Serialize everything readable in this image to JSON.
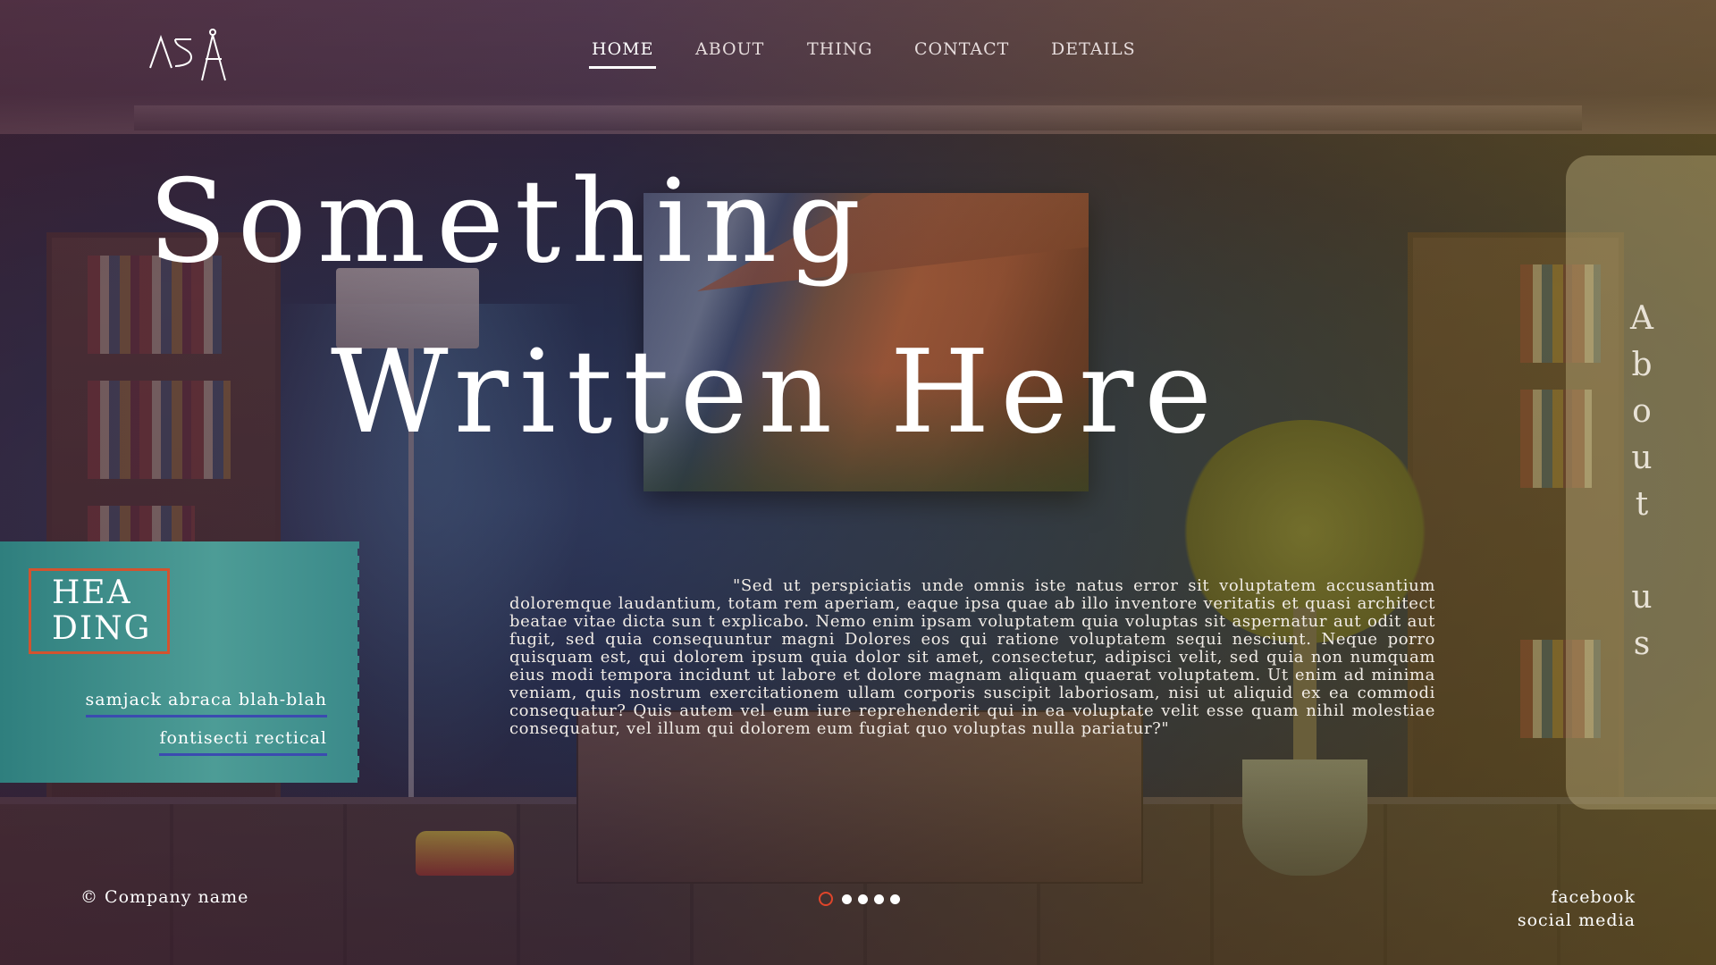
{
  "header": {
    "logo_icon": "compass-logo-icon",
    "nav": [
      {
        "label": "HOME",
        "active": true
      },
      {
        "label": "ABOUT",
        "active": false
      },
      {
        "label": "THING",
        "active": false
      },
      {
        "label": "CONTACT",
        "active": false
      },
      {
        "label": "DETAILS",
        "active": false
      }
    ]
  },
  "hero": {
    "line1": "Something",
    "line2": "Written Here"
  },
  "quote": "\"Sed ut perspiciatis unde omnis iste natus error sit voluptatem accusantium doloremque laudantium, totam rem aperiam, eaque ipsa quae ab illo inventore veritatis et quasi architect beatae vitae dicta sun t explicabo. Nemo enim ipsam voluptatem quia voluptas sit aspernatur aut odit aut fugit, sed quia consequuntur magni Dolores eos qui ratione voluptatem sequi nesciunt. Neque porro quisquam est, qui dolorem ipsum quia dolor sit amet, consectetur, adipisci velit, sed quia non numquam eius modi tempora incidunt ut labore et dolore magnam aliquam quaerat voluptatem. Ut enim ad minima veniam, quis nostrum exercitationem ullam corporis suscipit laboriosam, nisi ut aliquid ex ea commodi consequatur? Quis autem vel eum iure reprehenderit qui in ea voluptate velit esse quam nihil molestiae consequatur, vel illum qui dolorem eum fugiat quo voluptas nulla pariatur?\"",
  "card": {
    "heading_line1": "HEA",
    "heading_line2": "DING",
    "links": [
      "samjack abraca blah-blah",
      "fontisecti rectical"
    ]
  },
  "about_panel": {
    "letters": [
      "A",
      "b",
      "o",
      "u",
      "t",
      "",
      "u",
      "s"
    ]
  },
  "footer": {
    "copyright_symbol": "©",
    "company": "Company name",
    "slider": {
      "total": 5,
      "active_index": 0
    },
    "social_links": [
      "facebook",
      "social media"
    ]
  },
  "colors": {
    "accent": "#e0452a",
    "card_teal": "#3b8a8a",
    "link_underline": "#3b4bb0"
  }
}
